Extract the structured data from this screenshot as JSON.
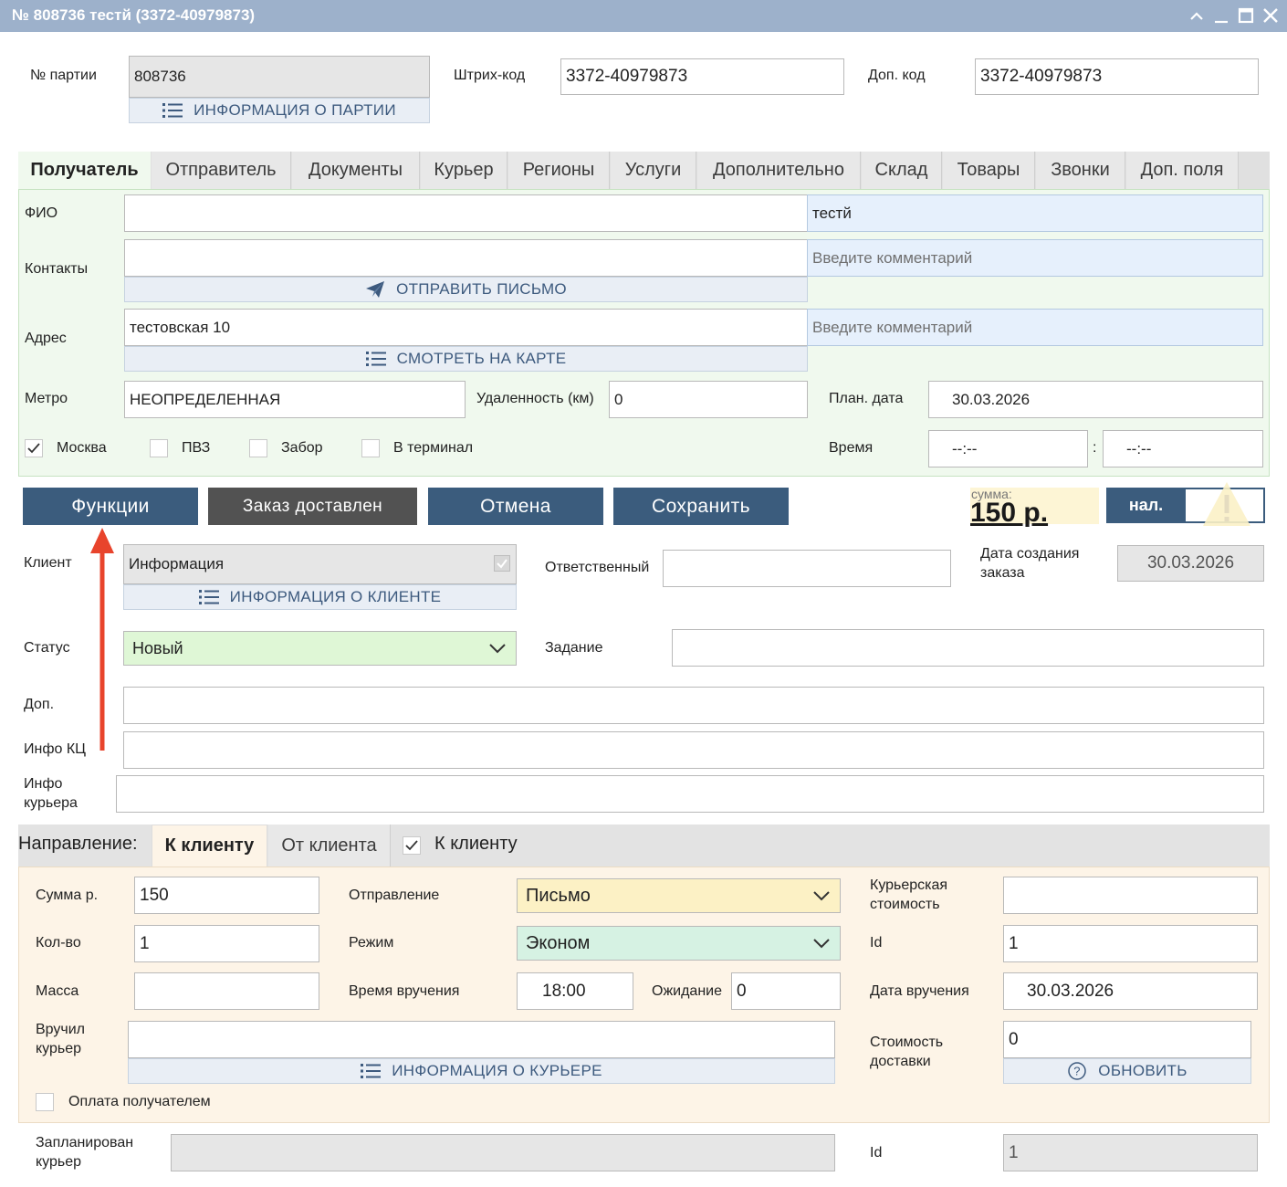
{
  "window": {
    "title": "№ 808736 тестй (3372-40979873)",
    "controls": [
      "chevron-up-icon",
      "minimize-icon",
      "maximize-icon",
      "close-icon"
    ]
  },
  "header": {
    "batch_label": "№ партии",
    "batch_value": "808736",
    "batch_info_link": "ИНФОРМАЦИЯ О ПАРТИИ",
    "barcode_label": "Штрих-код",
    "barcode_value": "3372-40979873",
    "extra_code_label": "Доп. код",
    "extra_code_value": "3372-40979873"
  },
  "tabs": [
    "Получатель",
    "Отправитель",
    "Документы",
    "Курьер",
    "Регионы",
    "Услуги",
    "Дополнительно",
    "Склад",
    "Товары",
    "Звонки",
    "Доп. поля"
  ],
  "recipient": {
    "fio_label": "ФИО",
    "fio_value": "",
    "fio_comment": "тестй",
    "contacts_label": "Контакты",
    "contacts_value": "",
    "contacts_comment_placeholder": "Введите комментарий",
    "send_letter_link": "ОТПРАВИТЬ ПИСЬМО",
    "address_label": "Адрес",
    "address_value": "тестовская 10",
    "address_comment_placeholder": "Введите  комментарий",
    "map_link": "СМОТРЕТЬ НА КАРТЕ",
    "metro_label": "Метро",
    "metro_value": "НЕОПРЕДЕЛЕННАЯ",
    "distance_label": "Удаленность (км)",
    "distance_value": "0",
    "plan_date_label": "План. дата",
    "plan_date_value": "30.03.2026",
    "checkboxes": [
      {
        "label": "Москва",
        "checked": true
      },
      {
        "label": "ПВЗ",
        "checked": false
      },
      {
        "label": "Забор",
        "checked": false
      },
      {
        "label": "В терминал",
        "checked": false
      }
    ],
    "time_label": "Время",
    "time_from": "--:--",
    "time_sep": ":",
    "time_to": "--:--"
  },
  "actions": {
    "functions": "Функции",
    "delivered": "Заказ доставлен",
    "cancel": "Отмена",
    "save": "Сохранить",
    "sum_label": "сумма:",
    "sum_value": "150 р.",
    "payment_toggle": "нал."
  },
  "client": {
    "client_label": "Клиент",
    "client_value": "Информация",
    "client_info_link": "ИНФОРМАЦИЯ О КЛИЕНТЕ",
    "responsible_label": "Ответственный",
    "responsible_value": "",
    "created_label": "Дата создания заказа",
    "created_value": "30.03.2026",
    "status_label": "Статус",
    "status_value": "Новый",
    "task_label": "Задание",
    "task_value": "",
    "extra_label": "Доп.",
    "info_kc_label": "Инфо КЦ",
    "info_courier_label": "Инфо курьера"
  },
  "direction": {
    "label": "Направление:",
    "tab_to": "К клиенту",
    "tab_from": "От клиента",
    "checkbox_label": "К клиенту",
    "sum_label": "Сумма р.",
    "sum_value": "150",
    "qty_label": "Кол-во",
    "qty_value": "1",
    "mass_label": "Масса",
    "mass_value": "",
    "shipment_label": "Отправление",
    "shipment_value": "Письмо",
    "mode_label": "Режим",
    "mode_value": "Эконом",
    "handover_time_label": "Время вручения",
    "handover_time_value": "18:00",
    "waiting_label": "Ожидание",
    "waiting_value": "0",
    "courier_cost_label": "Курьерская стоимость",
    "courier_cost_value": "",
    "id_label": "Id",
    "id_value": "1",
    "handover_date_label": "Дата вручения",
    "handover_date_value": "30.03.2026",
    "handed_by_label": "Вручил курьер",
    "handed_by_value": "",
    "courier_info_link": "ИНФОРМАЦИЯ О КУРЬЕРЕ",
    "delivery_cost_label": "Стоимость доставки",
    "delivery_cost_value": "0",
    "refresh_link": "ОБНОВИТЬ",
    "recipient_pays_label": "Оплата получателем"
  },
  "planned": {
    "planned_courier_label": "Запланирован курьер",
    "planned_courier_value": "",
    "id_label": "Id",
    "id_value": "1"
  },
  "colors": {
    "titlebar": "#9db1cb",
    "button": "#3b5c7d",
    "status_bg": "#dff7d6",
    "shipment_bg": "#fcf1c5",
    "mode_bg": "#d6f2e3",
    "annotation_arrow": "#e8442c"
  }
}
